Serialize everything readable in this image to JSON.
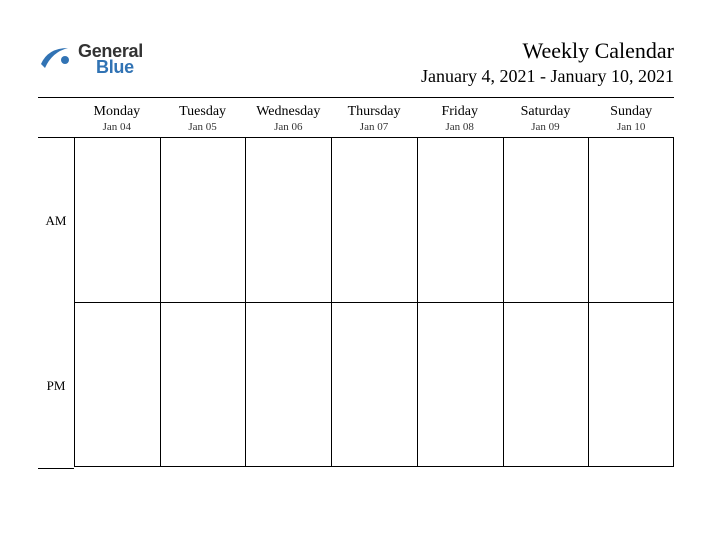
{
  "logo": {
    "general": "General",
    "blue": "Blue"
  },
  "header": {
    "title": "Weekly Calendar",
    "range": "January 4, 2021 - January 10, 2021"
  },
  "days": [
    {
      "name": "Monday",
      "date": "Jan 04"
    },
    {
      "name": "Tuesday",
      "date": "Jan 05"
    },
    {
      "name": "Wednesday",
      "date": "Jan 06"
    },
    {
      "name": "Thursday",
      "date": "Jan 07"
    },
    {
      "name": "Friday",
      "date": "Jan 08"
    },
    {
      "name": "Saturday",
      "date": "Jan 09"
    },
    {
      "name": "Sunday",
      "date": "Jan 10"
    }
  ],
  "periods": {
    "am": "AM",
    "pm": "PM"
  }
}
